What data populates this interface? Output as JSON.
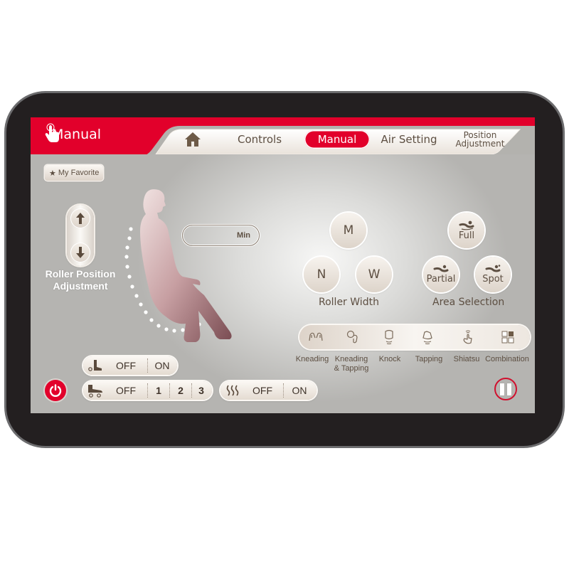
{
  "header": {
    "title": "Manual",
    "title_icon": "hand-touch-icon",
    "accent_color": "#e2002b"
  },
  "nav": {
    "home_icon": "home-icon",
    "tabs": [
      {
        "label": "Controls",
        "active": false
      },
      {
        "label": "Manual",
        "active": true
      },
      {
        "label": "Air Setting",
        "active": false
      },
      {
        "label_line1": "Position",
        "label_line2": "Adjustment",
        "active": false
      }
    ]
  },
  "favorite": {
    "label": "My Favorite",
    "icon": "star-icon"
  },
  "roller_position": {
    "up_icon": "arrow-up-icon",
    "down_icon": "arrow-down-icon",
    "label_line1": "Roller Position",
    "label_line2": "Adjustment"
  },
  "timer": {
    "value": "",
    "unit": "Min"
  },
  "roller_width": {
    "label": "Roller Width",
    "options": [
      "M",
      "N",
      "W"
    ]
  },
  "area_selection": {
    "label": "Area Selection",
    "options": [
      "Full",
      "Partial",
      "Spot"
    ]
  },
  "techniques": [
    {
      "label": "Kneading",
      "icon": "kneading-hands-icon"
    },
    {
      "label_line1": "Kneading",
      "label_line2": "& Tapping",
      "icon": "kneading-tapping-icon"
    },
    {
      "label": "Knock",
      "icon": "fist-knock-icon"
    },
    {
      "label": "Tapping",
      "icon": "tapping-hand-icon"
    },
    {
      "label": "Shiatsu",
      "icon": "finger-press-icon"
    },
    {
      "label": "Combination",
      "icon": "grid-combination-icon"
    }
  ],
  "calf_roller": {
    "icon": "calf-boot-icon",
    "options": [
      "OFF",
      "ON"
    ]
  },
  "foot_roller": {
    "icon": "foot-roller-icon",
    "options": [
      "OFF",
      "1",
      "2",
      "3"
    ]
  },
  "heat": {
    "icon": "heat-icon",
    "options": [
      "OFF",
      "ON"
    ]
  },
  "power": {
    "icon": "power-icon"
  },
  "pause": {
    "icon": "pause-icon"
  }
}
